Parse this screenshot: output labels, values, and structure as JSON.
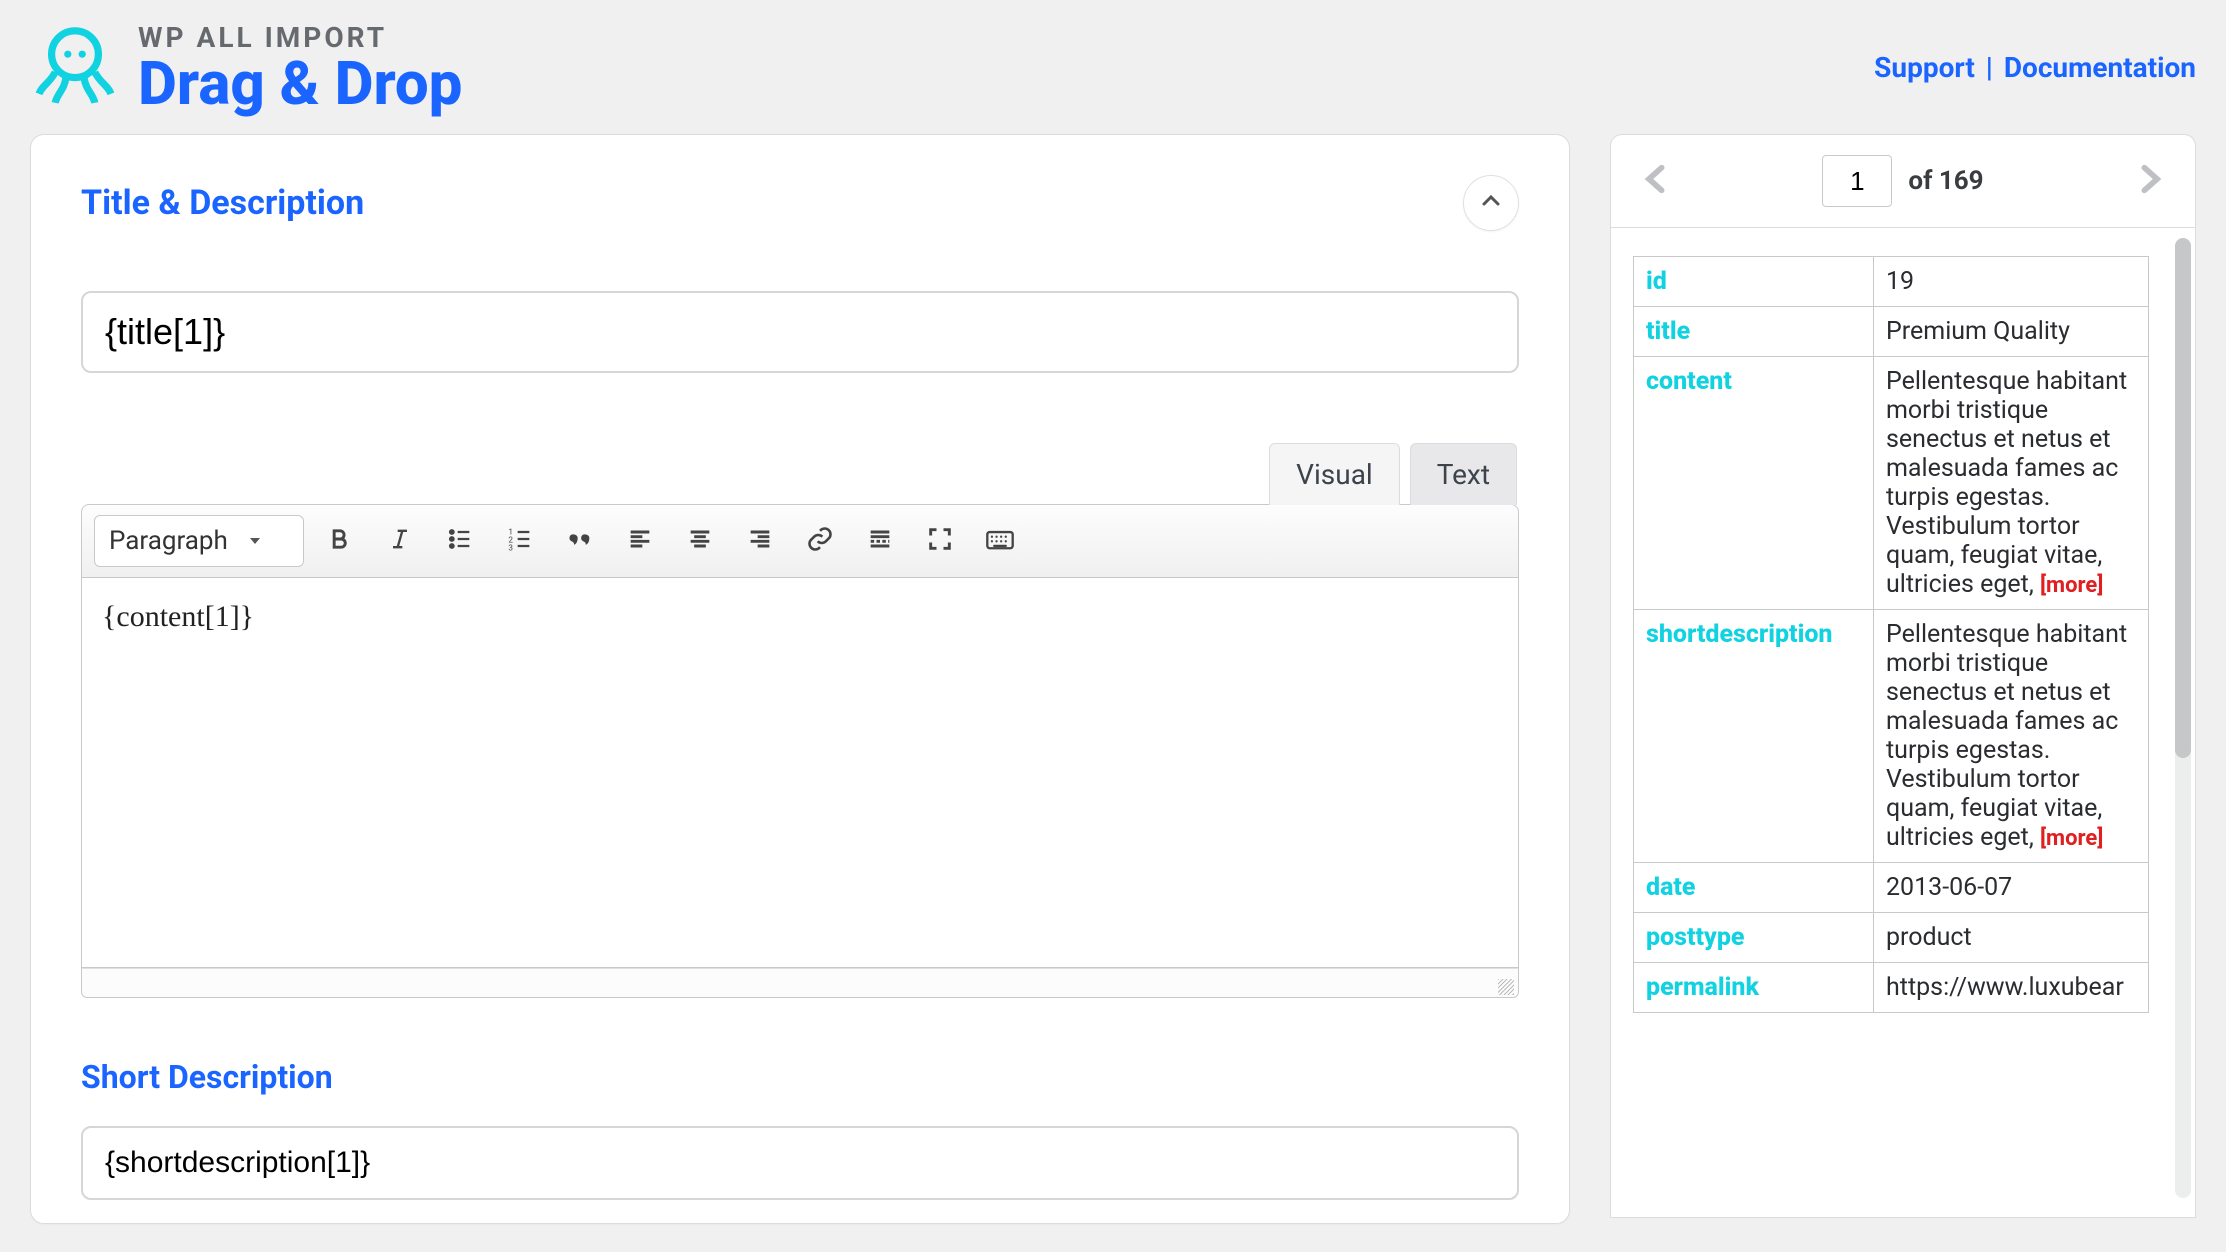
{
  "header": {
    "logo_sub": "WP ALL IMPORT",
    "logo_main": "Drag & Drop",
    "support_label": "Support",
    "docs_label": "Documentation"
  },
  "panel": {
    "section_title": "Title & Description",
    "title_value": "{title[1]}",
    "tabs": {
      "visual": "Visual",
      "text": "Text"
    },
    "format_select": "Paragraph",
    "content_value": "{content[1]}",
    "short_section_title": "Short Description",
    "short_value": "{shortdescription[1]}"
  },
  "pager": {
    "current": "1",
    "total_label": "of 169"
  },
  "record": {
    "rows": [
      {
        "key": "id",
        "val": "19"
      },
      {
        "key": "title",
        "val": "Premium Quality"
      },
      {
        "key": "content",
        "val": "Pellentesque habitant morbi tristique senectus et netus et malesuada fames ac turpis egestas. Vestibulum tortor quam, feugiat vitae, ultricies eget, ",
        "more": true
      },
      {
        "key": "shortdescription",
        "val": "Pellentesque habitant morbi tristique senectus et netus et malesuada fames ac turpis egestas. Vestibulum tortor quam, feugiat vitae, ultricies eget, ",
        "more": true
      },
      {
        "key": "date",
        "val": "2013-06-07"
      },
      {
        "key": "posttype",
        "val": "product"
      },
      {
        "key": "permalink",
        "val": "https://www.luxubear"
      }
    ],
    "more_label": "[more]"
  }
}
